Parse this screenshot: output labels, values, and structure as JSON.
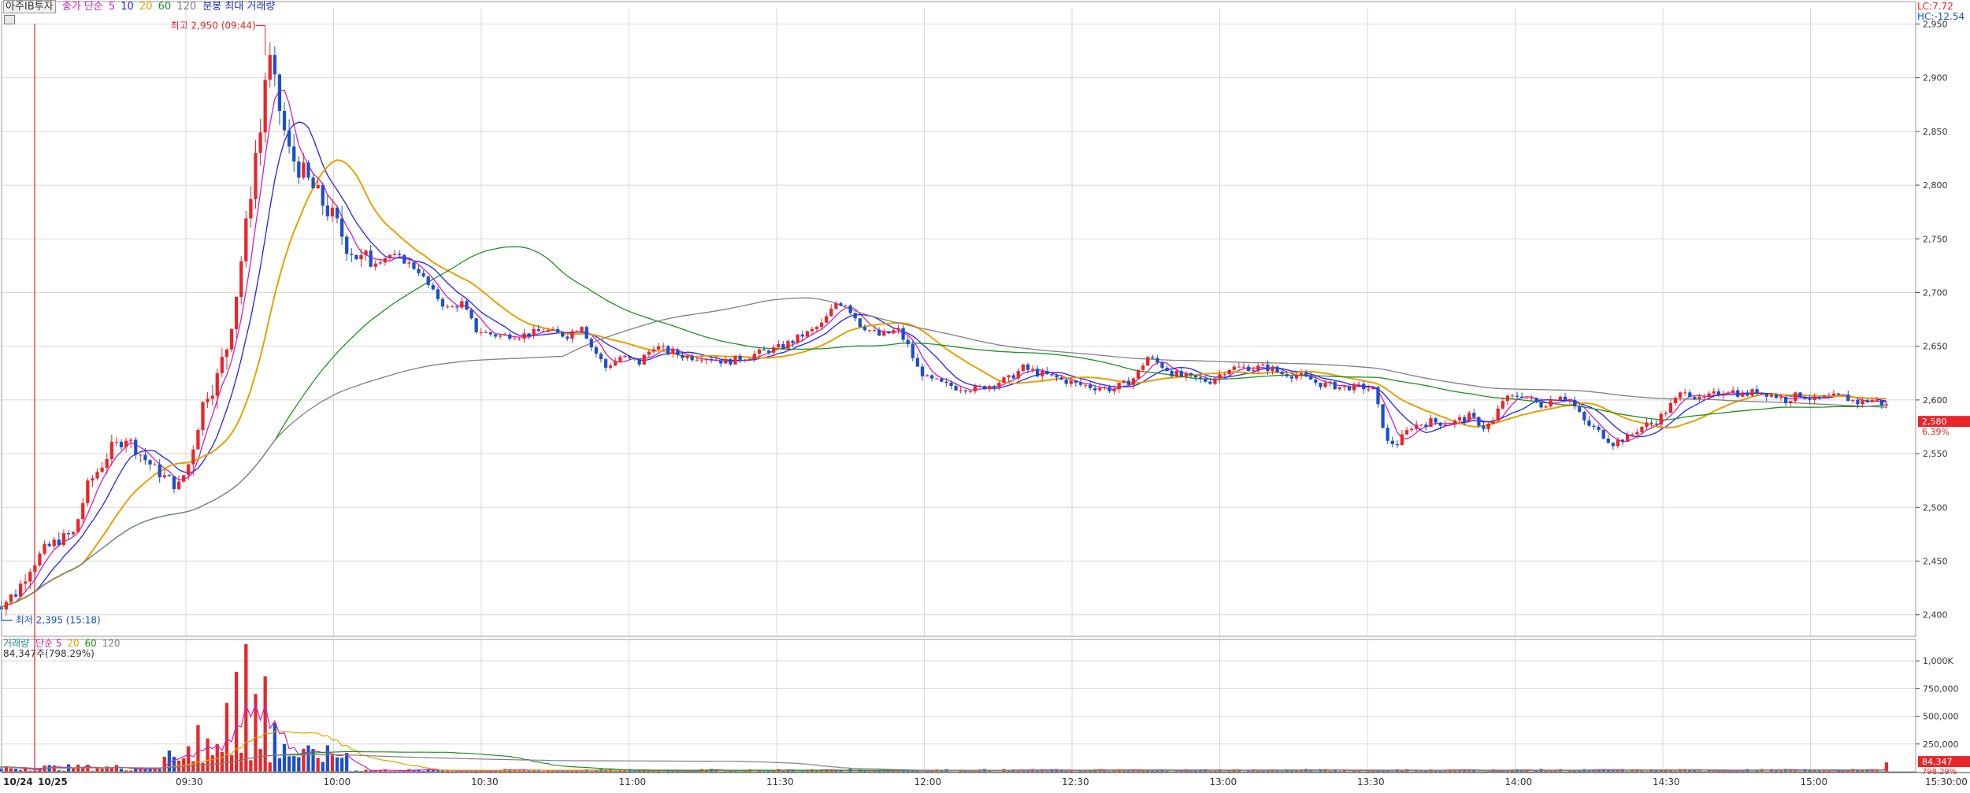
{
  "header": {
    "stock_name": "아주IB투자",
    "price_ma_label": "종가 단순",
    "ma_periods": [
      "5",
      "10",
      "20",
      "60",
      "120"
    ],
    "ma_colors": [
      "#d020c0",
      "#2020ff",
      "#e8a000",
      "#209020",
      "#808080"
    ],
    "minute_label": "분봉 최대 거래량",
    "lc_label": "LC:7.72",
    "hc_label": "HC:-12.54"
  },
  "volume_header": {
    "title": "거래량",
    "ma_label": "단순",
    "ma_periods": [
      "5",
      "20",
      "60",
      "120"
    ],
    "ma_colors": [
      "#d020c0",
      "#e8a000",
      "#209020",
      "#808080"
    ],
    "current": "84,347주(798.29%)"
  },
  "annotations": {
    "high": "최고 2,950 (09:44)",
    "low": "최저 2,395 (15:18)",
    "current_price": "2,580",
    "current_change": "6.39%",
    "current_volume": "84,347",
    "current_volume_pct": "798.29%"
  },
  "colors": {
    "up": "#e8262a",
    "down": "#1c4fc8",
    "grid": "#d8d8d8",
    "axis": "#555555"
  },
  "chart_data": [
    {
      "type": "candlestick",
      "title": "",
      "y_ticks": [
        "2,950",
        "2,900",
        "2,850",
        "2,800",
        "2,750",
        "2,700",
        "2,650",
        "2,600",
        "2,550",
        "2,500",
        "2,450",
        "2,400"
      ],
      "x_ticks": [
        "09:30",
        "10:00",
        "10:30",
        "11:00",
        "11:30",
        "12:00",
        "12:30",
        "13:00",
        "13:30",
        "14:00",
        "14:30",
        "15:00",
        "15:30:00"
      ],
      "date_labels": [
        "10/24",
        "10/25"
      ],
      "ylim": [
        2380,
        2965
      ],
      "last_price": 2580,
      "high": 2950,
      "low": 2395,
      "series_path": [
        [
          -5,
          2410
        ],
        [
          -3,
          2410
        ],
        [
          0,
          2420
        ],
        [
          3,
          2445
        ],
        [
          6,
          2460
        ],
        [
          9,
          2470
        ],
        [
          12,
          2475
        ],
        [
          15,
          2520
        ],
        [
          18,
          2540
        ],
        [
          20,
          2555
        ],
        [
          23,
          2565
        ],
        [
          26,
          2550
        ],
        [
          29,
          2535
        ],
        [
          32,
          2525
        ],
        [
          34,
          2520
        ],
        [
          36,
          2540
        ],
        [
          38,
          2580
        ],
        [
          40,
          2610
        ],
        [
          42,
          2620
        ],
        [
          44,
          2650
        ],
        [
          46,
          2700
        ],
        [
          48,
          2760
        ],
        [
          50,
          2830
        ],
        [
          51,
          2850
        ],
        [
          52,
          2900
        ],
        [
          53,
          2915
        ],
        [
          55,
          2870
        ],
        [
          57,
          2830
        ],
        [
          60,
          2810
        ],
        [
          63,
          2790
        ],
        [
          66,
          2770
        ],
        [
          69,
          2745
        ],
        [
          72,
          2730
        ],
        [
          75,
          2730
        ],
        [
          78,
          2735
        ],
        [
          81,
          2730
        ],
        [
          84,
          2720
        ],
        [
          87,
          2700
        ],
        [
          90,
          2685
        ],
        [
          93,
          2690
        ],
        [
          96,
          2665
        ],
        [
          100,
          2660
        ],
        [
          105,
          2660
        ],
        [
          110,
          2665
        ],
        [
          115,
          2660
        ],
        [
          118,
          2670
        ],
        [
          120,
          2650
        ],
        [
          123,
          2630
        ],
        [
          126,
          2640
        ],
        [
          130,
          2635
        ],
        [
          133,
          2650
        ],
        [
          136,
          2645
        ],
        [
          140,
          2640
        ],
        [
          144,
          2640
        ],
        [
          148,
          2635
        ],
        [
          152,
          2640
        ],
        [
          156,
          2645
        ],
        [
          160,
          2650
        ],
        [
          164,
          2660
        ],
        [
          168,
          2670
        ],
        [
          171,
          2690
        ],
        [
          173,
          2690
        ],
        [
          176,
          2670
        ],
        [
          180,
          2660
        ],
        [
          184,
          2665
        ],
        [
          186,
          2650
        ],
        [
          188,
          2630
        ],
        [
          190,
          2620
        ],
        [
          193,
          2615
        ],
        [
          196,
          2612
        ],
        [
          200,
          2610
        ],
        [
          204,
          2615
        ],
        [
          207,
          2620
        ],
        [
          210,
          2630
        ],
        [
          213,
          2625
        ],
        [
          217,
          2620
        ],
        [
          221,
          2615
        ],
        [
          225,
          2612
        ],
        [
          229,
          2610
        ],
        [
          233,
          2620
        ],
        [
          236,
          2640
        ],
        [
          238,
          2635
        ],
        [
          241,
          2625
        ],
        [
          245,
          2620
        ],
        [
          249,
          2618
        ],
        [
          253,
          2630
        ],
        [
          257,
          2630
        ],
        [
          261,
          2630
        ],
        [
          264,
          2625
        ],
        [
          268,
          2622
        ],
        [
          272,
          2615
        ],
        [
          276,
          2612
        ],
        [
          280,
          2612
        ],
        [
          283,
          2610
        ],
        [
          286,
          2560
        ],
        [
          288,
          2560
        ],
        [
          291,
          2575
        ],
        [
          295,
          2580
        ],
        [
          299,
          2578
        ],
        [
          303,
          2585
        ],
        [
          306,
          2575
        ],
        [
          308,
          2580
        ],
        [
          310,
          2600
        ],
        [
          314,
          2605
        ],
        [
          318,
          2595
        ],
        [
          322,
          2605
        ],
        [
          324,
          2600
        ],
        [
          327,
          2580
        ],
        [
          330,
          2570
        ],
        [
          333,
          2560
        ],
        [
          336,
          2565
        ],
        [
          339,
          2575
        ],
        [
          342,
          2580
        ],
        [
          345,
          2595
        ],
        [
          348,
          2610
        ],
        [
          351,
          2600
        ],
        [
          354,
          2605
        ],
        [
          357,
          2610
        ],
        [
          360,
          2605
        ],
        [
          363,
          2608
        ],
        [
          366,
          2605
        ],
        [
          369,
          2600
        ],
        [
          372,
          2605
        ],
        [
          375,
          2600
        ],
        [
          378,
          2602
        ],
        [
          381,
          2603
        ],
        [
          384,
          2598
        ],
        [
          387,
          2600
        ],
        [
          390,
          2595
        ]
      ],
      "volume": {
        "ylim": [
          0,
          1150000
        ],
        "y_ticks": [
          "1,000K",
          "750,000",
          "500,000",
          "250,000"
        ],
        "tick_values": [
          1000000,
          750000,
          500000,
          250000
        ],
        "last": 84347,
        "peak_bars": [
          [
            36,
            230000
          ],
          [
            38,
            420000
          ],
          [
            40,
            300000
          ],
          [
            42,
            250000
          ],
          [
            44,
            620000
          ],
          [
            46,
            900000
          ],
          [
            48,
            1150000
          ],
          [
            50,
            700000
          ],
          [
            52,
            860000
          ],
          [
            54,
            440000
          ],
          [
            56,
            250000
          ]
        ]
      }
    }
  ]
}
